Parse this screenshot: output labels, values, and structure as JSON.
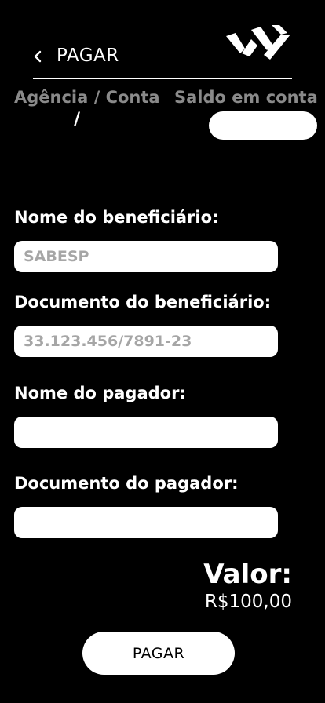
{
  "header": {
    "title": "PAGAR"
  },
  "account": {
    "label": "Agência / Conta",
    "value": "/"
  },
  "balance": {
    "label": "Saldo em conta",
    "value": ""
  },
  "form": {
    "beneficiary_name": {
      "label": "Nome do beneficiário:",
      "value": "SABESP",
      "placeholder": ""
    },
    "beneficiary_document": {
      "label": "Documento do beneficiário:",
      "value": "33.123.456/7891-23",
      "placeholder": ""
    },
    "payer_name": {
      "label": "Nome do pagador:",
      "value": "",
      "placeholder": ""
    },
    "payer_document": {
      "label": "Documento do pagador:",
      "value": "",
      "placeholder": ""
    }
  },
  "summary": {
    "valor_label": "Valor:",
    "valor_amount": "R$100,00"
  },
  "actions": {
    "pay_label": "PAGAR"
  },
  "colors": {
    "background": "#000000",
    "text": "#ffffff",
    "muted": "#8a8a8a",
    "input_text": "#a6a6a6"
  },
  "icons": {
    "back": "chevron-left-icon",
    "logo": "brand-logo"
  }
}
